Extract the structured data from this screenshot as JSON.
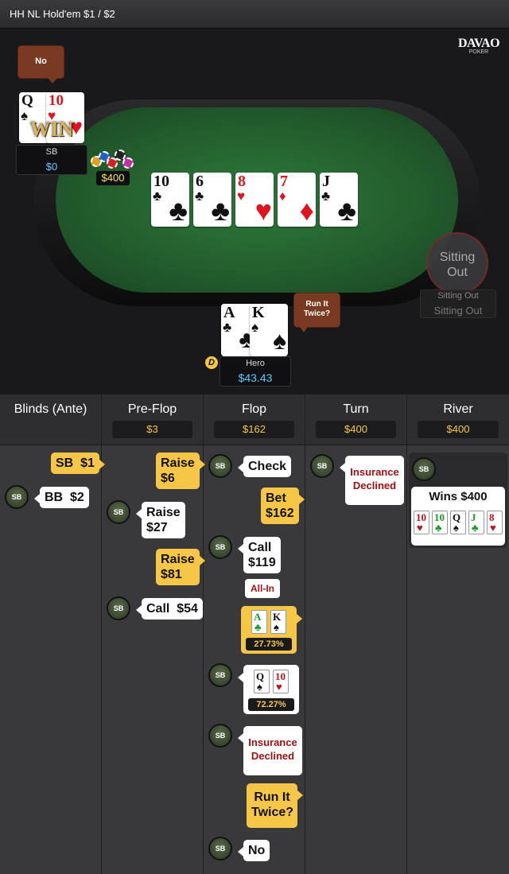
{
  "header": {
    "title": "HH NL Hold'em $1 / $2"
  },
  "table": {
    "logo_top": "DAVAO",
    "logo_bottom": "POKER",
    "sb_player": {
      "speech": "No",
      "cards": [
        {
          "rank": "Q",
          "suit": "♠"
        },
        {
          "rank": "10",
          "suit": "♥"
        }
      ],
      "win_label": "WIN",
      "name": "SB",
      "stack": "$0",
      "bet": "$400"
    },
    "board": [
      {
        "rank": "10",
        "suit": "♣",
        "color": "#111111"
      },
      {
        "rank": "6",
        "suit": "♣",
        "color": "#111111"
      },
      {
        "rank": "8",
        "suit": "♥",
        "color": "#e0141e"
      },
      {
        "rank": "7",
        "suit": "♦",
        "color": "#e0141e"
      },
      {
        "rank": "J",
        "suit": "♣",
        "color": "#111111"
      }
    ],
    "empty_seat": {
      "label": "Sitting Out",
      "status1": "Sitting Out",
      "status2": "Sitting Out"
    },
    "hero": {
      "speech": "Run It Twice?",
      "cards": [
        {
          "rank": "A",
          "suit": "♣"
        },
        {
          "rank": "K",
          "suit": "♠"
        }
      ],
      "dealer": "D",
      "name": "Hero",
      "stack": "$43.43"
    }
  },
  "history": {
    "columns": [
      {
        "title": "Blinds (Ante)",
        "pot": ""
      },
      {
        "title": "Pre-Flop",
        "pot": "$3"
      },
      {
        "title": "Flop",
        "pot": "$162"
      },
      {
        "title": "Turn",
        "pot": "$400"
      },
      {
        "title": "River",
        "pot": "$400"
      }
    ],
    "blinds": {
      "sb": "SB  $1",
      "bb": "BB  $2",
      "bb_chip": "SB"
    },
    "preflop": {
      "raise1": "Raise\n$6",
      "raise2": "Raise\n$27",
      "raise3": "Raise\n$81",
      "call": "Call  $54",
      "chip": "SB"
    },
    "flop": {
      "check": "Check",
      "bet": "Bet\n$162",
      "call": "Call\n$119",
      "allin": "All-In",
      "hero_equity": "27.73%",
      "villain_equity": "72.27%",
      "insurance": "Insurance\nDeclined",
      "rit": "Run It\nTwice?",
      "no": "No",
      "chip": "SB"
    },
    "turn": {
      "insurance": "Insurance\nDeclined",
      "chip": "SB"
    },
    "river": {
      "wins": "Wins $400",
      "chip": "SB",
      "hand": [
        {
          "rank": "10",
          "suit": "♥",
          "color": "#c0141e"
        },
        {
          "rank": "10",
          "suit": "♣",
          "color": "#1a9a2a"
        },
        {
          "rank": "Q",
          "suit": "♠",
          "color": "#111111"
        },
        {
          "rank": "J",
          "suit": "♣",
          "color": "#1a9a2a"
        },
        {
          "rank": "8",
          "suit": "♥",
          "color": "#c0141e"
        }
      ]
    },
    "mini_hero": [
      {
        "rank": "A",
        "suit": "♣",
        "color": "#1a9a2a"
      },
      {
        "rank": "K",
        "suit": "♠",
        "color": "#111111"
      }
    ],
    "mini_villain": [
      {
        "rank": "Q",
        "suit": "♠",
        "color": "#111111"
      },
      {
        "rank": "10",
        "suit": "♥",
        "color": "#c0141e"
      }
    ]
  }
}
